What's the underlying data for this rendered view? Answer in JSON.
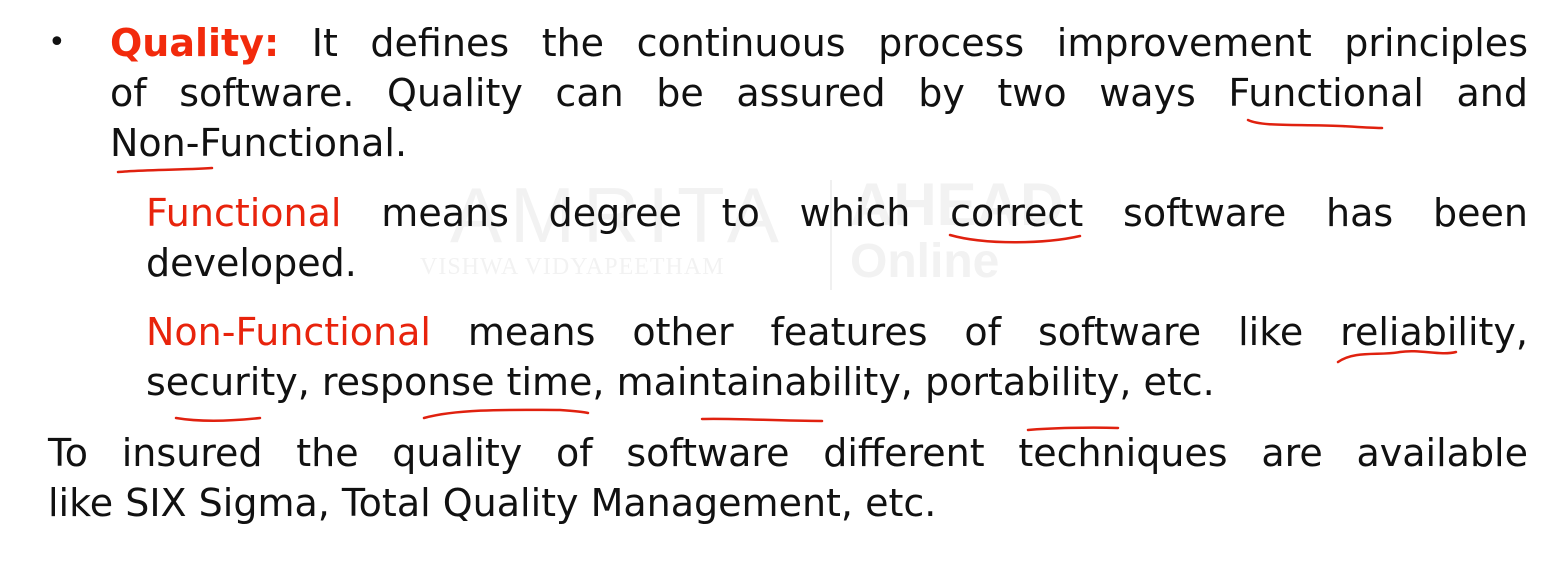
{
  "watermark": {
    "main": "AMRITA",
    "sub": "VISHWA VIDYAPEETHAM",
    "right_top": "AHEAD",
    "right_bottom": "Online"
  },
  "bullet_symbol": "•",
  "quality": {
    "label": "Quality:",
    "line1": "It defines the continuous process improvement principles",
    "line2": "of software. Quality can be assured by two ways Functional and",
    "line3": "Non-Functional."
  },
  "functional": {
    "label": "Functional",
    "line1_rest": " means degree to which correct software has been",
    "line2": "developed."
  },
  "non_functional": {
    "label": "Non-Functional",
    "line1_rest": " means other features of software like reliability,",
    "line2": "security, response time, maintainability, portability, etc."
  },
  "techniques": {
    "line1": "To insured the quality of software different techniques are available",
    "line2": "like SIX Sigma, Total Quality Management, etc."
  },
  "colors": {
    "accent_red": "#e8230c",
    "annotation_red": "#e0210f",
    "text": "#111111"
  }
}
